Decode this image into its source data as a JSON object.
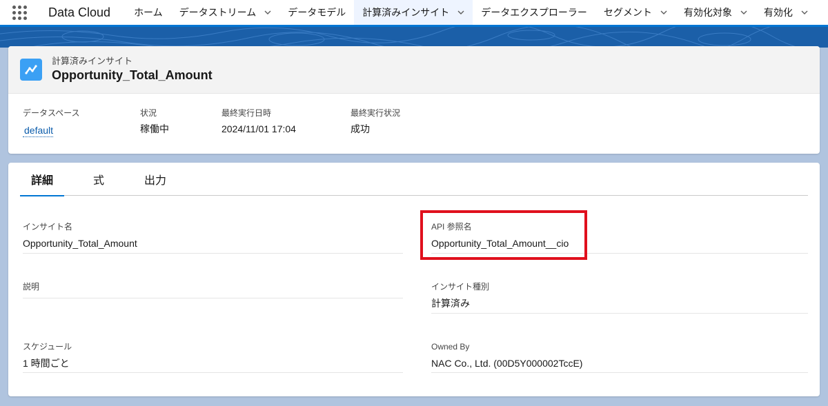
{
  "app": {
    "name": "Data Cloud"
  },
  "nav": {
    "items": [
      {
        "label": "ホーム",
        "dropdown": false,
        "active": false
      },
      {
        "label": "データストリーム",
        "dropdown": true,
        "active": false
      },
      {
        "label": "データモデル",
        "dropdown": false,
        "active": false
      },
      {
        "label": "計算済みインサイト",
        "dropdown": true,
        "active": true
      },
      {
        "label": "データエクスプローラー",
        "dropdown": false,
        "active": false
      },
      {
        "label": "セグメント",
        "dropdown": true,
        "active": false
      },
      {
        "label": "有効化対象",
        "dropdown": true,
        "active": false
      },
      {
        "label": "有効化",
        "dropdown": true,
        "active": false
      }
    ]
  },
  "header": {
    "object_label": "計算済みインサイト",
    "record_title": "Opportunity_Total_Amount",
    "icon": "insight-chart-icon",
    "highlights": [
      {
        "label": "データスペース",
        "value": "default",
        "link": true
      },
      {
        "label": "状況",
        "value": "稼働中",
        "link": false
      },
      {
        "label": "最終実行日時",
        "value": "2024/11/01 17:04",
        "link": false
      },
      {
        "label": "最終実行状況",
        "value": "成功",
        "link": false
      }
    ]
  },
  "tabs": [
    {
      "label": "詳細",
      "active": true
    },
    {
      "label": "式",
      "active": false
    },
    {
      "label": "出力",
      "active": false
    }
  ],
  "fields": {
    "insight_name": {
      "label": "インサイト名",
      "value": "Opportunity_Total_Amount"
    },
    "api_name": {
      "label": "API 参照名",
      "value": "Opportunity_Total_Amount__cio"
    },
    "description": {
      "label": "説明",
      "value": ""
    },
    "insight_type": {
      "label": "インサイト種別",
      "value": "計算済み"
    },
    "schedule": {
      "label": "スケジュール",
      "value": "1 時間ごと"
    },
    "owned_by": {
      "label": "Owned By",
      "value": "NAC Co., Ltd. (00D5Y000002TccE)"
    }
  },
  "colors": {
    "brand": "#0176d3",
    "highlight_box": "#e0101d",
    "link": "#0b5cab",
    "icon_bg": "#3ba0f4"
  }
}
